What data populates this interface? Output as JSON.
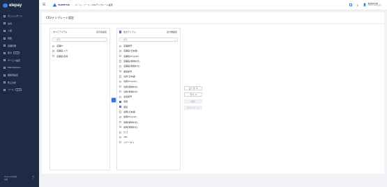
{
  "sidebar": {
    "brand": "elepay",
    "items": [
      {
        "label": "ダッシュボード",
        "icon": "dashboard-icon",
        "chevron": false,
        "badge": ""
      },
      {
        "label": "決済",
        "icon": "card-icon",
        "chevron": false,
        "badge": ""
      },
      {
        "label": "入金",
        "icon": "yen-icon",
        "chevron": true,
        "badge": ""
      },
      {
        "label": "返金",
        "icon": "refund-icon",
        "chevron": false,
        "badge": ""
      },
      {
        "label": "店舗管理",
        "icon": "store-icon",
        "chevron": true,
        "badge": ""
      },
      {
        "label": "集計",
        "icon": "chart-icon",
        "chevron": false,
        "badge": "BETA"
      },
      {
        "label": "サービス設定",
        "icon": "gear-icon",
        "chevron": true,
        "badge": ""
      },
      {
        "label": "Marketplace",
        "icon": "grid-icon",
        "chevron": false,
        "badge": ""
      },
      {
        "label": "開発者設定",
        "icon": "code-icon",
        "chevron": true,
        "badge": ""
      },
      {
        "label": "売上分析",
        "icon": "analytics-icon",
        "chevron": false,
        "badge": ""
      },
      {
        "label": "ツール",
        "icon": "tool-icon",
        "chevron": false,
        "badge": "BETA"
      }
    ],
    "footer_line1": "elepay 利用規約",
    "footer_line2": "各種"
  },
  "topbar": {
    "company": "ELESTYLE",
    "breadcrumb": [
      "ホーム",
      "ツール"
    ],
    "breadcrumb_current": "CSVテンプレート設定",
    "user_name": "ELESTYLE",
    "user_sub": "ELESTYLE株式会社"
  },
  "page": {
    "title": "CSVテンプレート設定"
  },
  "left_panel": {
    "title": "すべてアイテム",
    "link": "表示名設定",
    "search_placeholder": "検索",
    "items": [
      "店舗ID",
      "店舗名/メモ",
      "店舗名/名前"
    ]
  },
  "right_panel": {
    "title": "出力アイテム",
    "link": "出力順設定",
    "search_placeholder": "検索",
    "items": [
      {
        "label": "店舗番号",
        "checked": false
      },
      {
        "label": "店舗名(日本語)",
        "checked": false
      },
      {
        "label": "店舗名(English)",
        "checked": false
      },
      {
        "label": "店舗名(簡体中文)",
        "checked": false
      },
      {
        "label": "店舗名(繁體中文)",
        "checked": false
      },
      {
        "label": "郵便番号",
        "checked": false
      },
      {
        "label": "住所(日本語)",
        "checked": false
      },
      {
        "label": "住所(English)",
        "checked": false
      },
      {
        "label": "住所(簡体中文)",
        "checked": false
      },
      {
        "label": "住所(繁體中文)",
        "checked": false
      },
      {
        "label": "電話番号",
        "checked": false
      },
      {
        "label": "緯度",
        "checked": true
      },
      {
        "label": "経度",
        "checked": true
      },
      {
        "label": "説明(日本語)",
        "checked": false
      },
      {
        "label": "説明(English)",
        "checked": false
      },
      {
        "label": "説明(簡体中文)",
        "checked": false
      },
      {
        "label": "説明(繁體中文)",
        "checked": false
      },
      {
        "label": "ロゴ",
        "checked": false
      },
      {
        "label": "URL",
        "checked": false
      },
      {
        "label": "ステータス",
        "checked": false
      }
    ]
  },
  "controls": {
    "select_1": "ローカ",
    "select_2": "ラベ",
    "save": "保存",
    "download": "ダウンロード"
  }
}
